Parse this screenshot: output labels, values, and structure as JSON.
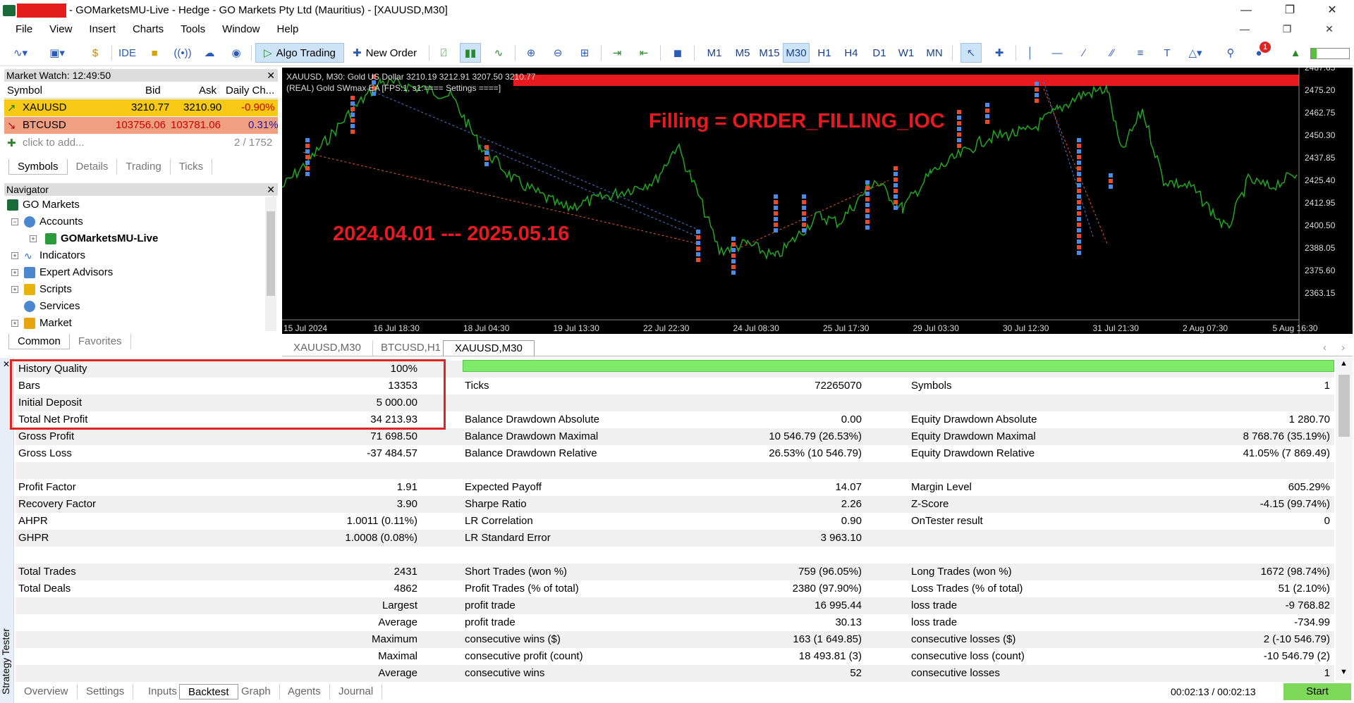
{
  "window": {
    "title": "- GOMarketsMU-Live - Hedge - GO Markets Pty Ltd (Mauritius) - [XAUUSD,M30]"
  },
  "menu": [
    "File",
    "View",
    "Insert",
    "Charts",
    "Tools",
    "Window",
    "Help"
  ],
  "toolbar": {
    "ide": "IDE",
    "algo": "Algo Trading",
    "new_order": "New Order",
    "timeframes": [
      "M1",
      "M5",
      "M15",
      "M30",
      "H1",
      "H4",
      "D1",
      "W1",
      "MN"
    ],
    "active_tf": "M30",
    "notif": "1"
  },
  "market_watch": {
    "title": "Market Watch: 12:49:50",
    "cols": [
      "Symbol",
      "Bid",
      "Ask",
      "Daily Ch..."
    ],
    "rows": [
      {
        "symbol": "XAUUSD",
        "bid": "3210.77",
        "ask": "3210.90",
        "change": "-0.90%",
        "bg": "#f5c914"
      },
      {
        "symbol": "BTCUSD",
        "bid": "103756.06",
        "ask": "103781.06",
        "change": "0.31%",
        "bg": "#f0a080"
      }
    ],
    "add": "click to add...",
    "count": "2 / 1752",
    "tabs": [
      "Symbols",
      "Details",
      "Trading",
      "Ticks"
    ]
  },
  "navigator": {
    "title": "Navigator",
    "items": [
      "GO Markets",
      "Accounts",
      "GOMarketsMU-Live",
      "Indicators",
      "Expert Advisors",
      "Scripts",
      "Services",
      "Market"
    ],
    "tabs": [
      "Common",
      "Favorites"
    ]
  },
  "chart": {
    "header": "XAUUSD, M30:  Gold US Dollar  3210.19 3212.91 3207.50 3210.77",
    "ea": "(REAL) Gold SWmax EA [FPS:1, s1:==== Settings ====]",
    "annot1": "Filling = ORDER_FILLING_IOC",
    "annot2": "2024.04.01 --- 2025.05.16",
    "prices": [
      "2487.65",
      "2475.20",
      "2462.75",
      "2450.30",
      "2437.85",
      "2425.40",
      "2412.95",
      "2400.50",
      "2388.05",
      "2375.60",
      "2363.15"
    ],
    "dates": [
      "15 Jul 2024",
      "16 Jul 18:30",
      "18 Jul 04:30",
      "19 Jul 13:30",
      "22 Jul 22:30",
      "24 Jul 08:30",
      "25 Jul 17:30",
      "29 Jul 03:30",
      "30 Jul 12:30",
      "31 Jul 21:30",
      "2 Aug 07:30",
      "5 Aug 16:30"
    ]
  },
  "chart_tabs": [
    "XAUUSD,M30",
    "BTCUSD,H1",
    "XAUUSD,M30"
  ],
  "tester": {
    "side_label": "Strategy Tester",
    "col1": [
      [
        "History Quality",
        "100%"
      ],
      [
        "Bars",
        "13353"
      ],
      [
        "Initial Deposit",
        "5 000.00"
      ],
      [
        "Total Net Profit",
        "34 213.93"
      ],
      [
        "Gross Profit",
        "71 698.50"
      ],
      [
        "Gross Loss",
        "-37 484.57"
      ],
      [
        "",
        ""
      ],
      [
        "Profit Factor",
        "1.91"
      ],
      [
        "Recovery Factor",
        "3.90"
      ],
      [
        "AHPR",
        "1.0011 (0.11%)"
      ],
      [
        "GHPR",
        "1.0008 (0.08%)"
      ],
      [
        "",
        ""
      ],
      [
        "Total Trades",
        "2431"
      ],
      [
        "Total Deals",
        "4862"
      ],
      [
        "",
        "Largest"
      ],
      [
        "",
        "Average"
      ],
      [
        "",
        "Maximum"
      ],
      [
        "",
        "Maximal"
      ],
      [
        "",
        "Average"
      ]
    ],
    "col2": [
      [
        "",
        ""
      ],
      [
        "Ticks",
        "72265070"
      ],
      [
        "",
        ""
      ],
      [
        "Balance Drawdown Absolute",
        "0.00"
      ],
      [
        "Balance Drawdown Maximal",
        "10 546.79 (26.53%)"
      ],
      [
        "Balance Drawdown Relative",
        "26.53% (10 546.79)"
      ],
      [
        "",
        ""
      ],
      [
        "Expected Payoff",
        "14.07"
      ],
      [
        "Sharpe Ratio",
        "2.26"
      ],
      [
        "LR Correlation",
        "0.90"
      ],
      [
        "LR Standard Error",
        "3 963.10"
      ],
      [
        "",
        ""
      ],
      [
        "Short Trades (won %)",
        "759 (96.05%)"
      ],
      [
        "Profit Trades (% of total)",
        "2380 (97.90%)"
      ],
      [
        "profit trade",
        "16 995.44"
      ],
      [
        "profit trade",
        "30.13"
      ],
      [
        "consecutive wins ($)",
        "163 (1 649.85)"
      ],
      [
        "consecutive profit (count)",
        "18 493.81 (3)"
      ],
      [
        "consecutive wins",
        "52"
      ]
    ],
    "col3": [
      [
        "",
        ""
      ],
      [
        "Symbols",
        "1"
      ],
      [
        "",
        ""
      ],
      [
        "Equity Drawdown Absolute",
        "1 280.70"
      ],
      [
        "Equity Drawdown Maximal",
        "8 768.76 (35.19%)"
      ],
      [
        "Equity Drawdown Relative",
        "41.05% (7 869.49)"
      ],
      [
        "",
        ""
      ],
      [
        "Margin Level",
        "605.29%"
      ],
      [
        "Z-Score",
        "-4.15 (99.74%)"
      ],
      [
        "OnTester result",
        "0"
      ],
      [
        "",
        ""
      ],
      [
        "",
        ""
      ],
      [
        "Long Trades (won %)",
        "1672 (98.74%)"
      ],
      [
        "Loss Trades (% of total)",
        "51 (2.10%)"
      ],
      [
        "loss trade",
        "-9 768.82"
      ],
      [
        "loss trade",
        "-734.99"
      ],
      [
        "consecutive losses ($)",
        "2 (-10 546.79)"
      ],
      [
        "consecutive loss (count)",
        "-10 546.79 (2)"
      ],
      [
        "consecutive losses",
        "1"
      ]
    ],
    "tabs": [
      "Overview",
      "Settings",
      "Inputs",
      "Backtest",
      "Graph",
      "Agents",
      "Journal"
    ],
    "active_tab": "Backtest",
    "timer": "00:02:13 / 00:02:13",
    "start": "Start"
  }
}
